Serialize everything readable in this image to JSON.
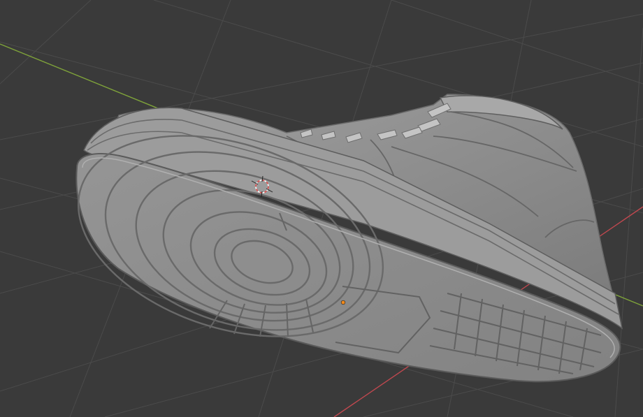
{
  "viewport": {
    "background_color": "#3a3a3a",
    "grid_color": "#4b4b4b",
    "x_axis_color": "#c0484f",
    "y_axis_color": "#7fa33a",
    "object_color": "#8c8c8c",
    "object_edge_color": "#6a6a6a",
    "object_highlight_color": "#b3b3b3",
    "object_shadow_color": "#5c5c5c",
    "cursor_color": "#e24a4a",
    "origin_color": "#f28a1a"
  },
  "scene": {
    "object": "sneaker-mesh",
    "icons": [
      "3d-cursor-icon",
      "object-origin-icon"
    ]
  }
}
